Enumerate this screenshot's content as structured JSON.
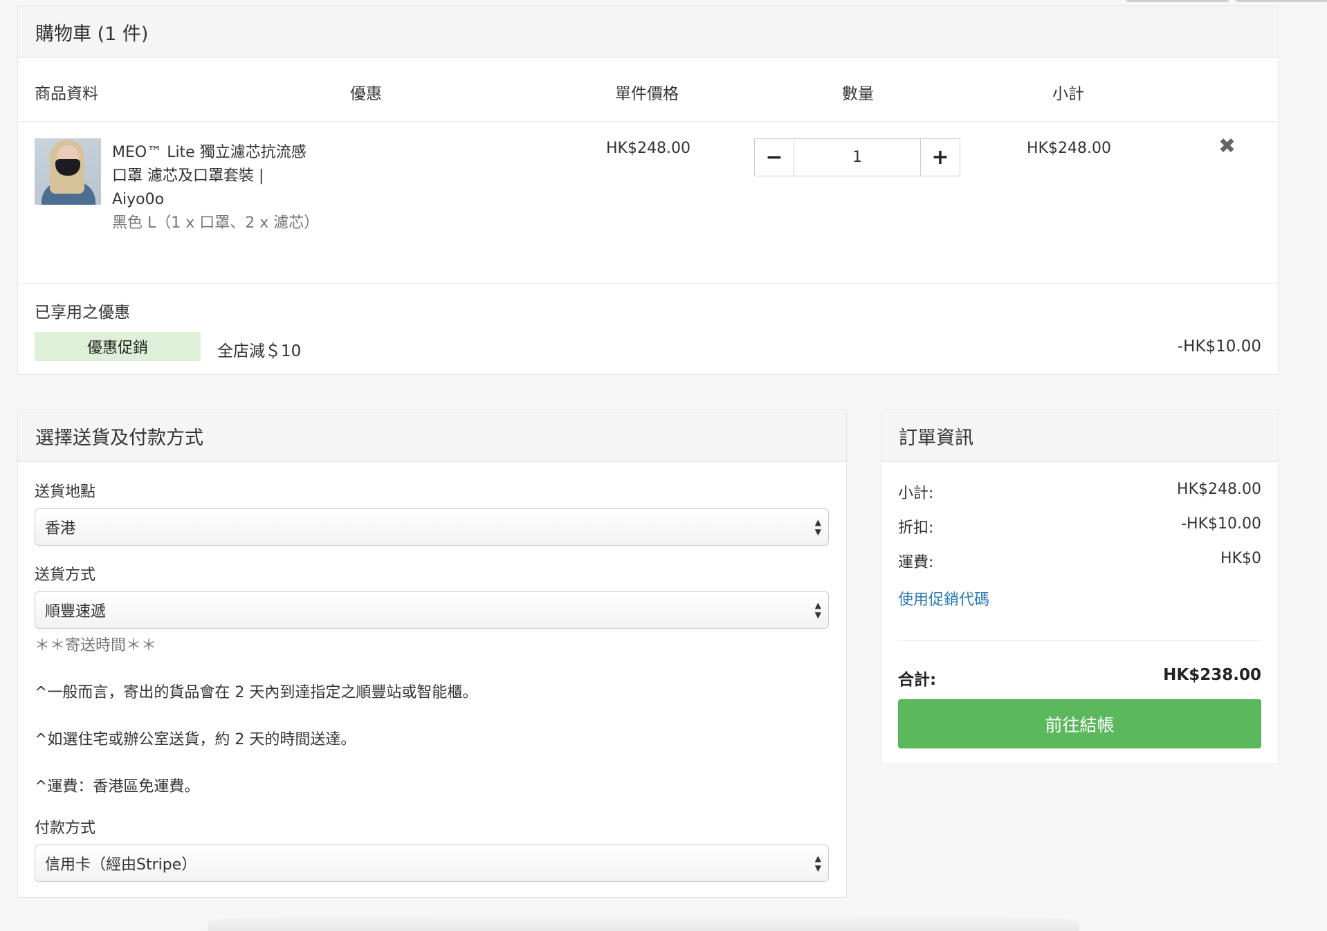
{
  "colors": {
    "accent_link": "#2a7ab8",
    "checkout_green": "#5cb85c",
    "promo_badge_bg": "#dff0d8"
  },
  "cart": {
    "title": "購物車 (1 件)",
    "headers": {
      "product": "商品資料",
      "discount": "優惠",
      "unit_price": "單件價格",
      "quantity": "數量",
      "subtotal": "小計"
    },
    "item": {
      "title": "MEO™ Lite 獨立濾芯抗流感口罩 濾芯及口罩套裝 | Aiyo0o",
      "variant": "黑色 L（1 x 口罩、2 x 濾芯）",
      "unit_price": "HK$248.00",
      "quantity": "1",
      "decrease_icon": "minus-icon",
      "increase_icon": "plus-icon",
      "subtotal": "HK$248.00",
      "remove_icon": "close-icon"
    },
    "promotions": {
      "title": "已享用之優惠",
      "badge": "優惠促銷",
      "description": "全店減＄10",
      "amount": "-HK$10.00"
    }
  },
  "shipping": {
    "title": "選擇送貨及付款方式",
    "location_label": "送貨地點",
    "location_value": "香港",
    "method_label": "送貨方式",
    "method_value": "順豐速遞",
    "time_heading": "＊＊寄送時間＊＊",
    "notes": [
      "^一般而言，寄出的貨品會在 2 天內到達指定之順豐站或智能櫃。",
      "^如選住宅或辦公室送貨，約 2 天的時間送達。",
      "^運費：香港區免運費。"
    ],
    "payment_label": "付款方式",
    "payment_value": "信用卡（經由Stripe）"
  },
  "order": {
    "title": "訂單資訊",
    "subtotal_label": "小計:",
    "subtotal_value": "HK$248.00",
    "discount_label": "折扣:",
    "discount_value": "-HK$10.00",
    "shipping_label": "運費:",
    "shipping_value": "HK$0",
    "coupon_link": "使用促銷代碼",
    "total_label": "合計:",
    "total_value": "HK$238.00",
    "checkout_button": "前往結帳"
  }
}
